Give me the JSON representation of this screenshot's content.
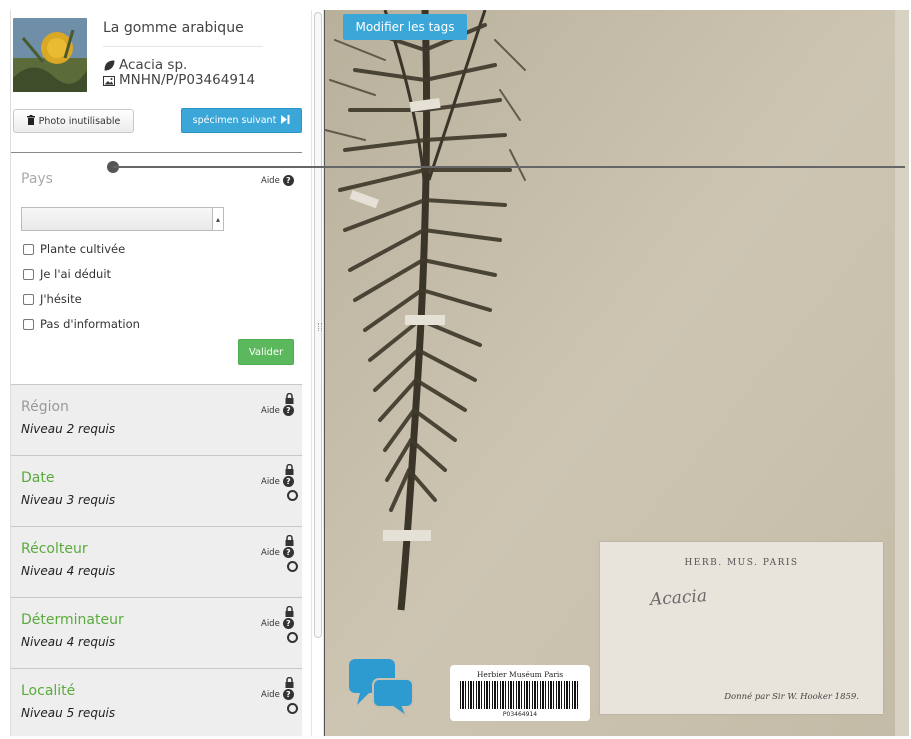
{
  "sidebar": {
    "title": "La gomme arabique",
    "species": "Acacia sp.",
    "specimen_code": "MNHN/P/P03464914",
    "photo_button_label": "Photo inutilisable",
    "next_button_label": "spécimen suivant",
    "pays": {
      "label": "Pays",
      "aide_label": "Aide",
      "select_value": "",
      "checkboxes": [
        "Plante cultivée",
        "Je l'ai déduit",
        "J'hésite",
        "Pas d'information"
      ],
      "submit_label": "Valider"
    },
    "sections": [
      {
        "title": "Région",
        "subtitle": "Niveau 2 requis",
        "aide_label": "Aide"
      },
      {
        "title": "Date",
        "subtitle": "Niveau 3 requis",
        "aide_label": "Aide"
      },
      {
        "title": "Récolteur",
        "subtitle": "Niveau 4 requis",
        "aide_label": "Aide"
      },
      {
        "title": "Déterminateur",
        "subtitle": "Niveau 4 requis",
        "aide_label": "Aide"
      },
      {
        "title": "Localité",
        "subtitle": "Niveau 5 requis",
        "aide_label": "Aide"
      }
    ]
  },
  "specimen": {
    "tags_button_label": "Modifier les tags",
    "label_header": "HERB. MUS. PARIS",
    "label_handwritten": "Acacia",
    "label_footer": "Donné par Sir W. Hooker 1859.",
    "barcode_title": "Herbier Muséum Paris",
    "barcode_number": "P03464914"
  },
  "colors": {
    "accent_blue": "#3ba6d8",
    "valider_green": "#5cb85c",
    "section_title_green": "#5aaa3c",
    "section_background": "#eeeeee",
    "sheet_background": "#c9c0ad"
  }
}
